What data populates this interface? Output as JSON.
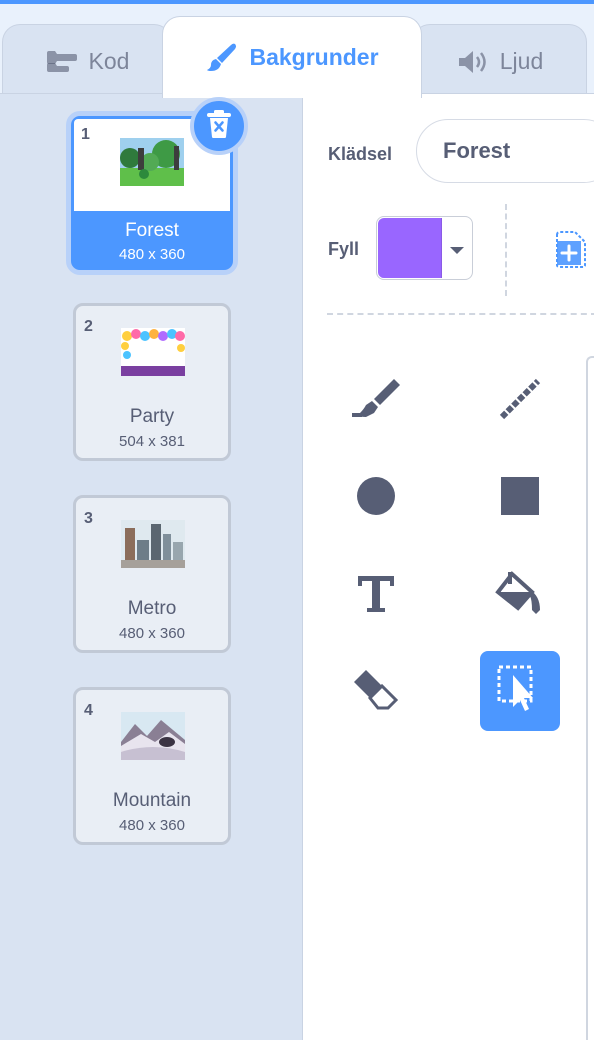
{
  "tabs": {
    "code_label": "Kod",
    "backdrops_label": "Bakgrunder",
    "sounds_label": "Ljud"
  },
  "backdrops": [
    {
      "number": "1",
      "name": "Forest",
      "size": "480 x 360",
      "selected": true
    },
    {
      "number": "2",
      "name": "Party",
      "size": "504 x 381",
      "selected": false
    },
    {
      "number": "3",
      "name": "Metro",
      "size": "480 x 360",
      "selected": false
    },
    {
      "number": "4",
      "name": "Mountain",
      "size": "480 x 360",
      "selected": false
    }
  ],
  "editor": {
    "costume_label": "Klädsel",
    "costume_name": "Forest",
    "fill_label": "Fyll",
    "fill_color": "#9966ff"
  },
  "tools": [
    "brush-icon",
    "line-icon",
    "circle-icon",
    "rectangle-icon",
    "text-icon",
    "fill-bucket-icon",
    "eraser-icon",
    "select-icon"
  ],
  "colors": {
    "accent": "#4c97ff",
    "tool_icon": "#575e75",
    "selected_border": "#b8d1f9"
  }
}
